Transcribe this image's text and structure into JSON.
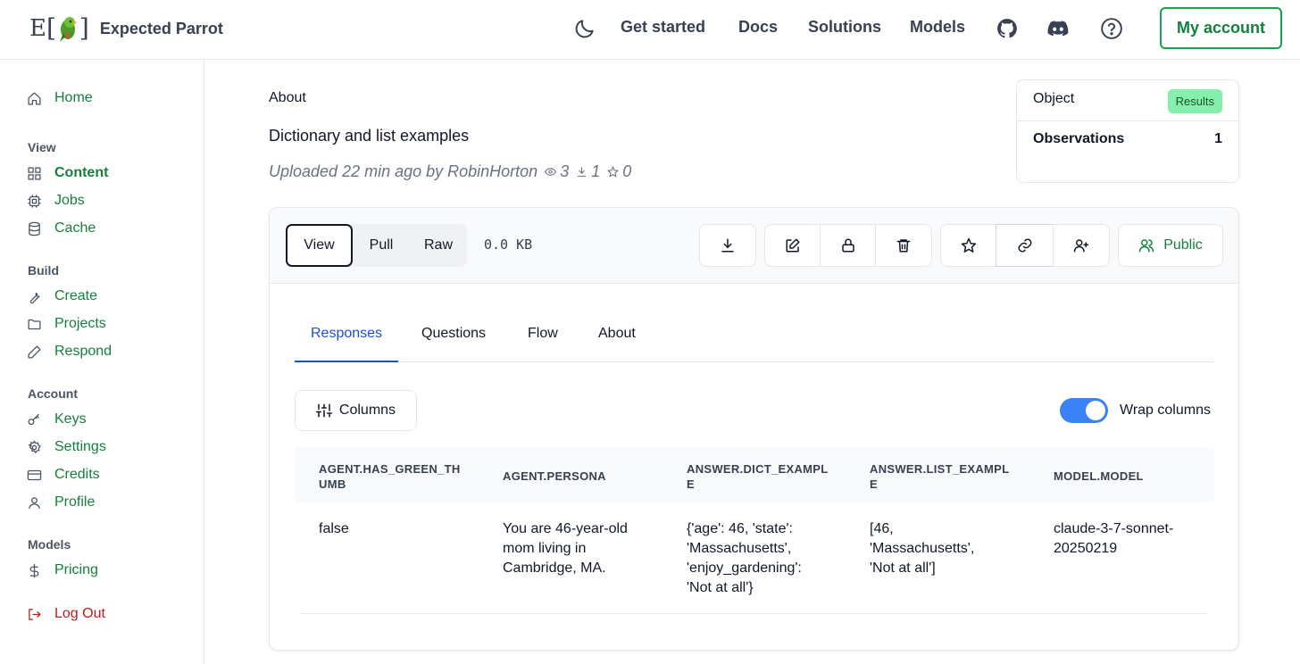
{
  "header": {
    "logo_e": "E",
    "logo_open": "[",
    "logo_close": "]",
    "brand_name": "Expected Parrot",
    "nav": [
      "Get started",
      "Docs",
      "Solutions",
      "Models"
    ],
    "icons": [
      "moon-icon",
      "github-icon",
      "discord-icon",
      "help-icon"
    ],
    "account_label": "My account"
  },
  "sidebar": {
    "home": "Home",
    "sections": [
      {
        "title": "View",
        "items": [
          "Content",
          "Jobs",
          "Cache"
        ]
      },
      {
        "title": "Build",
        "items": [
          "Create",
          "Projects",
          "Respond"
        ]
      },
      {
        "title": "Account",
        "items": [
          "Keys",
          "Settings",
          "Credits",
          "Profile"
        ]
      },
      {
        "title": "Models",
        "items": [
          "Pricing"
        ]
      }
    ],
    "logout": "Log Out"
  },
  "object": {
    "about_label": "About",
    "description": "Dictionary and list examples",
    "uploaded": "Uploaded 22 min ago by RobinHorton",
    "views": "3",
    "downloads": "1",
    "stars": "0"
  },
  "object_card": {
    "object_label": "Object",
    "object_type": "Results",
    "observations_label": "Observations",
    "observations_value": "1"
  },
  "toolbar": {
    "view_modes": [
      "View",
      "Pull",
      "Raw"
    ],
    "active_mode": "View",
    "size": "0.0 KB",
    "visibility": "Public"
  },
  "tabs": {
    "items": [
      "Responses",
      "Questions",
      "Flow",
      "About"
    ],
    "active": "Responses"
  },
  "table_controls": {
    "columns_label": "Columns",
    "wrap_label": "Wrap columns",
    "wrap_enabled": true
  },
  "table": {
    "headers": [
      "AGENT.HAS_GREEN_THUMB",
      "AGENT.PERSONA",
      "ANSWER.DICT_EXAMPLE",
      "ANSWER.LIST_EXAMPLE",
      "MODEL.MODEL"
    ],
    "rows": [
      [
        "false",
        "You are 46-year-old mom living in Cambridge, MA.",
        "{'age': 46, 'state': 'Massachusetts', 'enjoy_gardening': 'Not at all'}",
        "[46, 'Massachusetts', 'Not at all']",
        "claude-3-7-sonnet-20250219"
      ]
    ]
  },
  "colors": {
    "accent_green": "#15803d",
    "active_tab_blue": "#1d4ed8",
    "toggle_blue": "#3b82f6",
    "badge_green": "#86efac",
    "logout_red": "#b91c1c"
  }
}
